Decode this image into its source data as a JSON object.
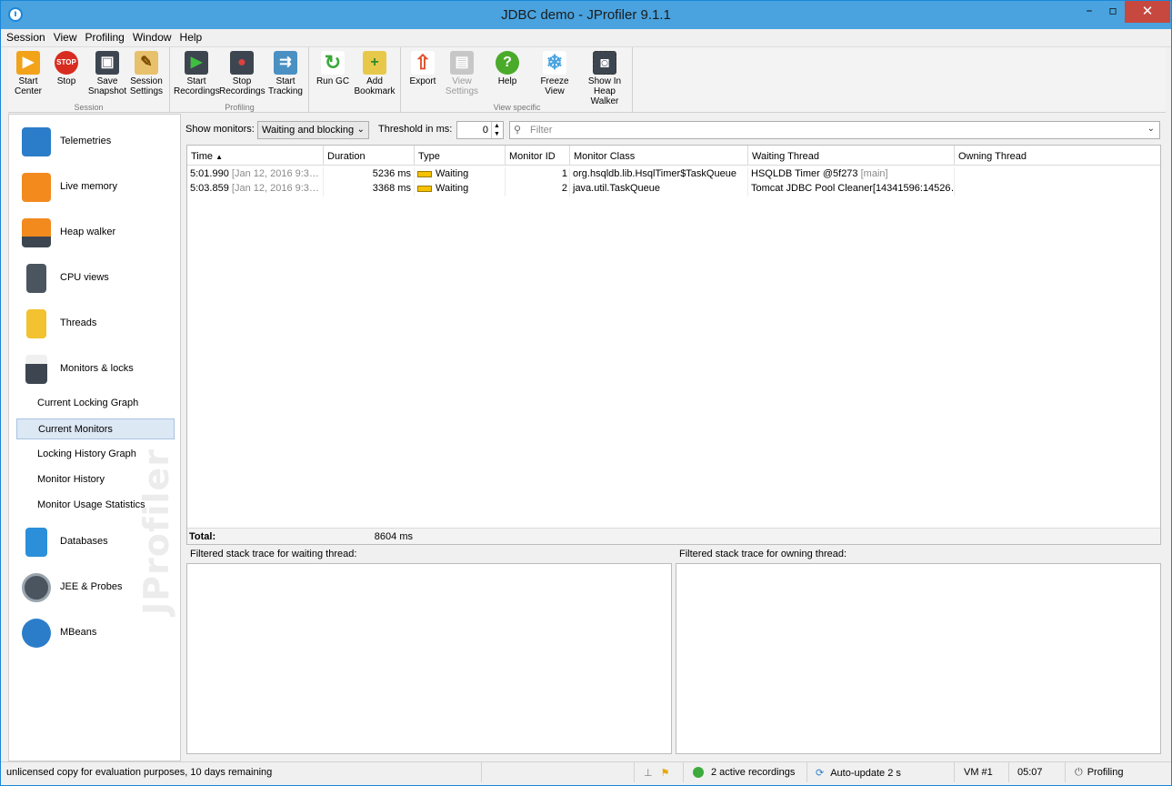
{
  "window": {
    "title": "JDBC demo - JProfiler 9.1.1"
  },
  "menu": [
    "Session",
    "View",
    "Profiling",
    "Window",
    "Help"
  ],
  "toolbar": {
    "groups": [
      {
        "title": "Session",
        "buttons": [
          {
            "label": "Start\nCenter",
            "icon": "start-center-icon"
          },
          {
            "label": "Stop",
            "icon": "stop-icon"
          },
          {
            "label": "Save\nSnapshot",
            "icon": "save-snapshot-icon"
          },
          {
            "label": "Session\nSettings",
            "icon": "session-settings-icon"
          }
        ]
      },
      {
        "title": "Profiling",
        "buttons": [
          {
            "label": "Start\nRecordings",
            "icon": "start-recordings-icon"
          },
          {
            "label": "Stop\nRecordings",
            "icon": "stop-recordings-icon"
          },
          {
            "label": "Start\nTracking",
            "icon": "start-tracking-icon"
          }
        ]
      },
      {
        "title": "",
        "buttons": [
          {
            "label": "Run GC",
            "icon": "run-gc-icon"
          },
          {
            "label": "Add\nBookmark",
            "icon": "add-bookmark-icon"
          }
        ]
      },
      {
        "title": "View specific",
        "buttons": [
          {
            "label": "Export",
            "icon": "export-icon"
          },
          {
            "label": "View\nSettings",
            "icon": "view-settings-icon",
            "disabled": true
          },
          {
            "label": "Help",
            "icon": "help-icon"
          },
          {
            "label": "Freeze\nView",
            "icon": "freeze-view-icon"
          },
          {
            "label": "Show In\nHeap Walker",
            "icon": "show-in-heap-walker-icon"
          }
        ]
      }
    ]
  },
  "sidebar": {
    "items": [
      {
        "label": "Telemetries",
        "icon": "telemetries-icon"
      },
      {
        "label": "Live memory",
        "icon": "live-memory-icon"
      },
      {
        "label": "Heap walker",
        "icon": "heap-walker-icon"
      },
      {
        "label": "CPU views",
        "icon": "cpu-views-icon"
      },
      {
        "label": "Threads",
        "icon": "threads-icon"
      },
      {
        "label": "Monitors & locks",
        "icon": "monitors-locks-icon"
      }
    ],
    "sub_items": [
      {
        "label": "Current Locking Graph",
        "selected": false
      },
      {
        "label": "Current Monitors",
        "selected": true
      },
      {
        "label": "Locking History Graph",
        "selected": false
      },
      {
        "label": "Monitor History",
        "selected": false
      },
      {
        "label": "Monitor Usage Statistics",
        "selected": false
      }
    ],
    "items_after": [
      {
        "label": "Databases",
        "icon": "databases-icon"
      },
      {
        "label": "JEE & Probes",
        "icon": "jee-probes-icon"
      },
      {
        "label": "MBeans",
        "icon": "mbeans-icon"
      }
    ],
    "watermark": "JProfiler"
  },
  "filters": {
    "show_monitors_label": "Show monitors:",
    "show_monitors_value": "Waiting and blocking",
    "threshold_label": "Threshold in ms:",
    "threshold_value": "0",
    "filter_placeholder": "Filter"
  },
  "table": {
    "columns": [
      "Time",
      "Duration",
      "Type",
      "Monitor ID",
      "Monitor Class",
      "Waiting Thread",
      "Owning Thread"
    ],
    "sort_indicator": "▲",
    "rows": [
      {
        "time": "5:01.990",
        "time_detail": "[Jan 12, 2016 9:3…",
        "duration": "5236 ms",
        "type": "Waiting",
        "monitor_id": "1",
        "monitor_class": "org.hsqldb.lib.HsqlTimer$TaskQueue",
        "waiting_thread": "HSQLDB Timer @5f273",
        "waiting_thread_detail": "[main]",
        "owning_thread": ""
      },
      {
        "time": "5:03.859",
        "time_detail": "[Jan 12, 2016 9:3…",
        "duration": "3368 ms",
        "type": "Waiting",
        "monitor_id": "2",
        "monitor_class": "java.util.TaskQueue",
        "waiting_thread": "Tomcat JDBC Pool Cleaner[14341596:14526…",
        "waiting_thread_detail": "",
        "owning_thread": ""
      }
    ],
    "total_label": "Total:",
    "total_duration": "8604 ms"
  },
  "stack": {
    "waiting_label": "Filtered stack trace for waiting thread:",
    "owning_label": "Filtered stack trace for owning thread:"
  },
  "status": {
    "license": "unlicensed copy for evaluation purposes, 10 days remaining",
    "recordings": "2 active recordings",
    "auto_update": "Auto-update 2 s",
    "vm": "VM #1",
    "time": "05:07",
    "mode": "Profiling"
  },
  "colors": {
    "titlebar": "#4aa3df",
    "selection": "#dde8f5",
    "waiting": "#f6c100",
    "close": "#c7483e"
  }
}
